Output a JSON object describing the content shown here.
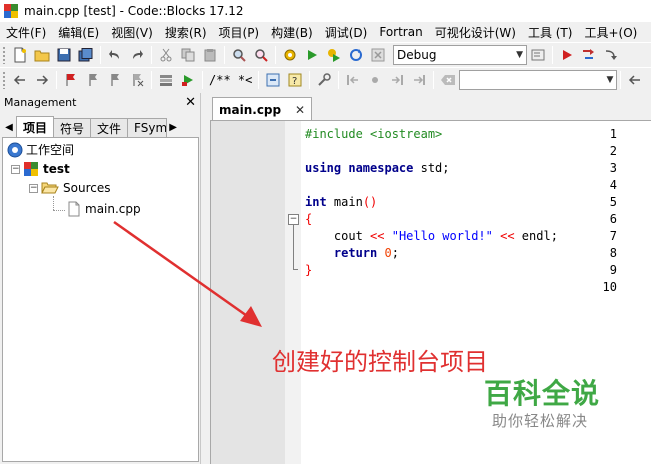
{
  "window": {
    "title": "main.cpp [test] - Code::Blocks 17.12"
  },
  "menu": [
    "文件(F)",
    "编辑(E)",
    "视图(V)",
    "搜索(R)",
    "项目(P)",
    "构建(B)",
    "调试(D)",
    "Fortran",
    "可视化设计(W)",
    "工具 (T)",
    "工具+(O)"
  ],
  "toolbar": {
    "build_target": "Debug",
    "doc_comment_label": "/** *<",
    "search_value": ""
  },
  "management": {
    "title": "Management",
    "tabs": [
      "项目",
      "符号",
      "文件",
      "FSym"
    ],
    "active_tab": "项目",
    "tree": {
      "workspace": "工作空间",
      "project": "test",
      "folder": "Sources",
      "file": "main.cpp"
    }
  },
  "editor": {
    "tab_label": "main.cpp",
    "line_numbers": [
      "1",
      "2",
      "3",
      "4",
      "5",
      "6",
      "7",
      "8",
      "9",
      "10"
    ]
  },
  "code": {
    "l1_directive": "#include",
    "l1_header": " <iostream>",
    "l3_kw1": "using",
    "l3_kw2": " namespace",
    "l3_rest": " std;",
    "l5_kw": "int",
    "l5_name": " main",
    "l5_parens": "()",
    "l6_brace": "{",
    "l7_indent": "    ",
    "l7_cout": "cout",
    "l7_op1": " <<",
    "l7_string": " \"Hello world!\"",
    "l7_op2": " <<",
    "l7_endl": " endl",
    "l7_semi": ";",
    "l8_indent": "    ",
    "l8_kw": "return",
    "l8_num": " 0",
    "l8_semi": ";",
    "l9_brace": "}"
  },
  "overlay": {
    "annotation": "创建好的控制台项目",
    "watermark_title": "百科全说",
    "watermark_sub": "助你轻松解决"
  },
  "colors": {
    "annotation": "#e03030",
    "watermark": "#3fa845",
    "keyword": "#00008b",
    "preprocessor": "#228b22",
    "string": "#0000ff",
    "number": "#f04000"
  }
}
